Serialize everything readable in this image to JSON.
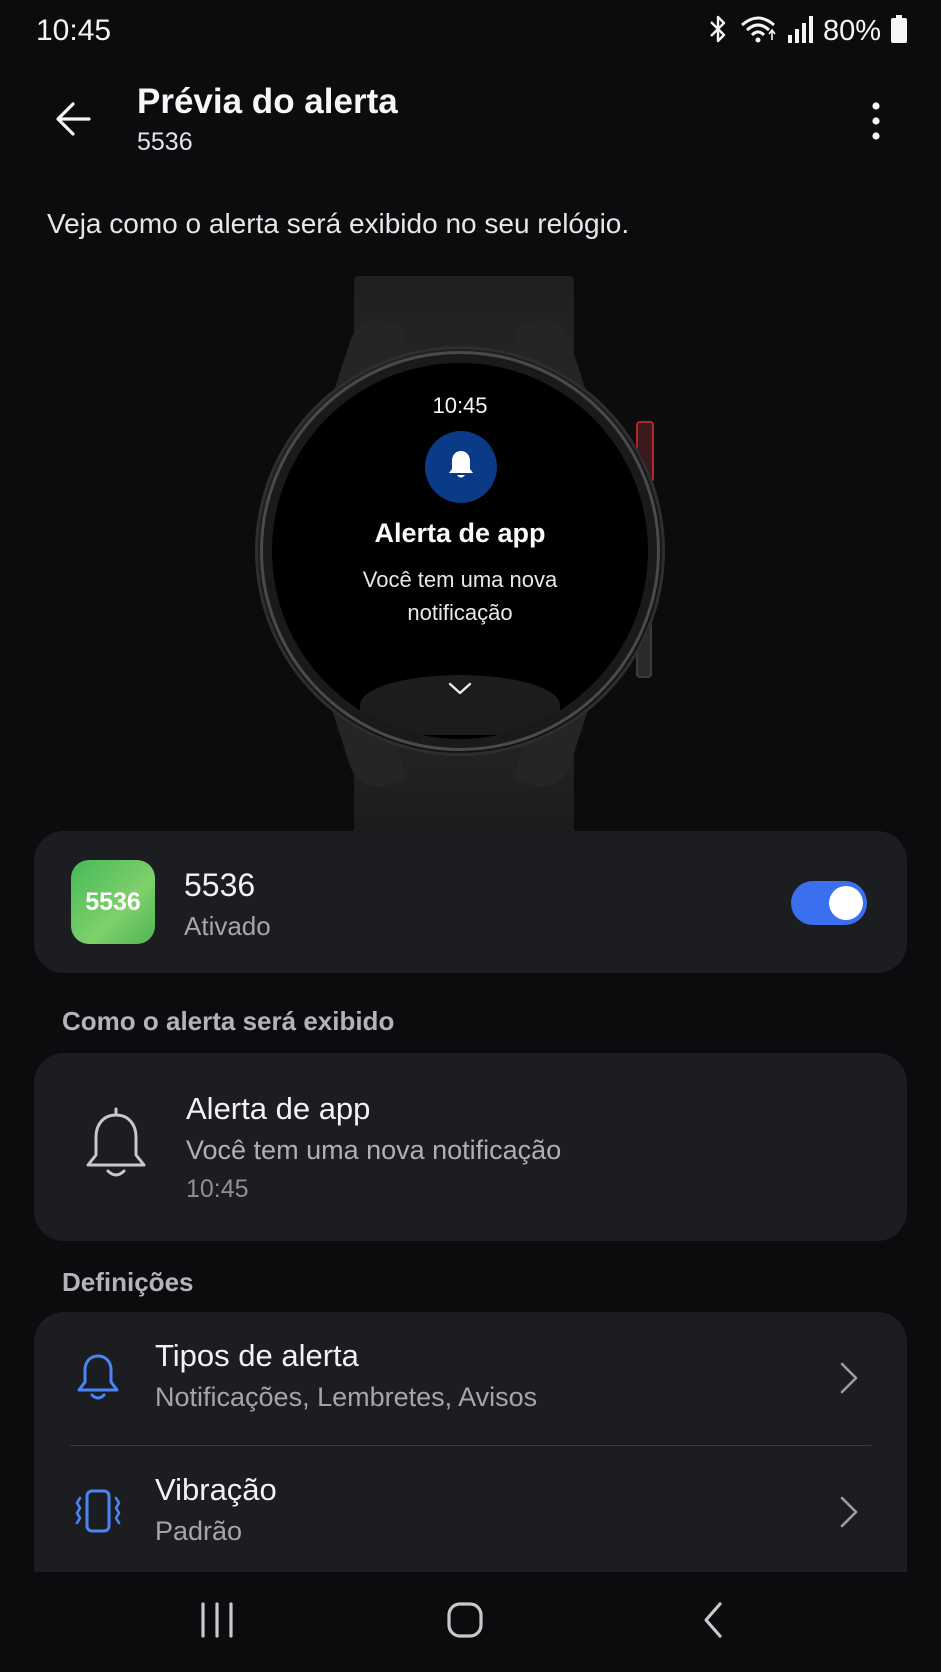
{
  "status_bar": {
    "time": "10:45",
    "battery": "80%",
    "icons": [
      "bluetooth-icon",
      "wifi-icon",
      "signal-icon",
      "battery-icon"
    ]
  },
  "app_bar": {
    "title": "Prévia do alerta",
    "subtitle": "5536",
    "back_icon": "arrow-left-icon",
    "more_icon": "more-vertical-icon"
  },
  "description": "Veja como o alerta será exibido no seu relógio.",
  "watch": {
    "time": "10:45",
    "title": "Alerta de app",
    "text": "Você tem uma nova notificação",
    "icon": "bell-icon"
  },
  "app": {
    "icon_text": "5536",
    "name": "5536",
    "status": "Ativado",
    "toggle_on": true
  },
  "section_display": "Como o alerta será exibido",
  "preview": {
    "title": "Alerta de app",
    "text": "Você tem uma nova notificação",
    "time": "10:45"
  },
  "section_settings": "Definições",
  "settings": [
    {
      "title": "Tipos de alerta",
      "subtitle": "Notificações, Lembretes, Avisos",
      "icon": "bell-icon"
    },
    {
      "title": "Vibração",
      "subtitle": "Padrão",
      "icon": "vibration-icon"
    }
  ],
  "colors": {
    "accent": "#3a6ff0",
    "background": "#0b0c0e",
    "card": "#1c1d21",
    "watch_bell_bg": "#0b3a86"
  }
}
